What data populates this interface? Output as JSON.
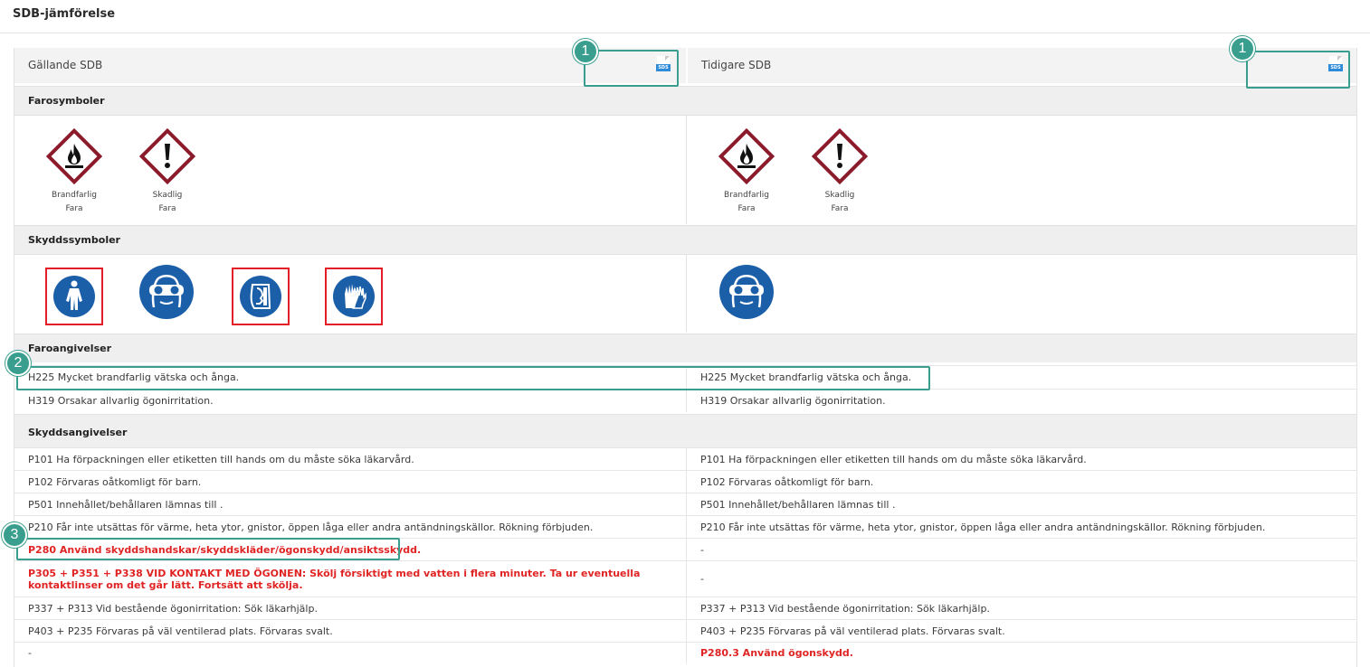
{
  "page": {
    "title": "SDB-jämförelse"
  },
  "columns": {
    "current": {
      "title": "Gällande SDB",
      "file_badge": "SDS"
    },
    "previous": {
      "title": "Tidigare SDB",
      "file_badge": "SDS"
    }
  },
  "sections": {
    "hazard_symbols": "Farosymboler",
    "protective_symbols": "Skyddssymboler",
    "hazard_statements": "Faroangivelser",
    "precautionary_statements": "Skyddsangivelser"
  },
  "hazard_symbols": {
    "current": [
      {
        "icon": "flame-pictogram-icon",
        "name": "Brandfarlig",
        "signal": "Fara"
      },
      {
        "icon": "exclamation-pictogram-icon",
        "name": "Skadlig",
        "signal": "Fara"
      }
    ],
    "previous": [
      {
        "icon": "flame-pictogram-icon",
        "name": "Brandfarlig",
        "signal": "Fara"
      },
      {
        "icon": "exclamation-pictogram-icon",
        "name": "Skadlig",
        "signal": "Fara"
      }
    ]
  },
  "protective_symbols": {
    "current": [
      {
        "icon": "protective-suit-icon",
        "highlighted": true
      },
      {
        "icon": "safety-goggles-icon",
        "highlighted": false
      },
      {
        "icon": "face-shield-icon",
        "highlighted": true
      },
      {
        "icon": "protective-gloves-icon",
        "highlighted": true
      }
    ],
    "previous": [
      {
        "icon": "safety-goggles-icon",
        "highlighted": false
      }
    ]
  },
  "hazard_statements": [
    {
      "current": "H225 Mycket brandfarlig vätska och ånga.",
      "previous": "H225 Mycket brandfarlig vätska och ånga.",
      "current_changed": false,
      "previous_changed": false
    },
    {
      "current": "H319 Orsakar allvarlig ögonirritation.",
      "previous": "H319 Orsakar allvarlig ögonirritation.",
      "current_changed": false,
      "previous_changed": false
    }
  ],
  "precautionary_statements": [
    {
      "current": "P101 Ha förpackningen eller etiketten till hands om du måste söka läkarvård.",
      "previous": "P101 Ha förpackningen eller etiketten till hands om du måste söka läkarvård.",
      "current_changed": false,
      "previous_changed": false
    },
    {
      "current": "P102 Förvaras oåtkomligt för barn.",
      "previous": "P102 Förvaras oåtkomligt för barn.",
      "current_changed": false,
      "previous_changed": false
    },
    {
      "current": "P501 Innehållet/behållaren lämnas till .",
      "previous": "P501 Innehållet/behållaren lämnas till .",
      "current_changed": false,
      "previous_changed": false
    },
    {
      "current": "P210 Får inte utsättas för värme, heta ytor, gnistor, öppen låga eller andra antändningskällor. Rökning förbjuden.",
      "previous": "P210 Får inte utsättas för värme, heta ytor, gnistor, öppen låga eller andra antändningskällor. Rökning förbjuden.",
      "current_changed": false,
      "previous_changed": false
    },
    {
      "current": "P280 Använd skyddshandskar/skyddskläder/ögonskydd/ansiktsskydd.",
      "previous": "-",
      "current_changed": true,
      "previous_changed": false
    },
    {
      "current": "P305 + P351 + P338 VID KONTAKT MED ÖGONEN: Skölj försiktigt med vatten i flera minuter. Ta ur eventuella kontaktlinser om det går lätt. Fortsätt att skölja.",
      "previous": "-",
      "current_changed": true,
      "previous_changed": false
    },
    {
      "current": "P337 + P313 Vid bestående ögonirritation: Sök läkarhjälp.",
      "previous": "P337 + P313 Vid bestående ögonirritation: Sök läkarhjälp.",
      "current_changed": false,
      "previous_changed": false
    },
    {
      "current": "P403 + P235 Förvaras på väl ventilerad plats. Förvaras svalt.",
      "previous": "P403 + P235 Förvaras på väl ventilerad plats. Förvaras svalt.",
      "current_changed": false,
      "previous_changed": false
    },
    {
      "current": "-",
      "previous": "P280.3 Använd ögonskydd.",
      "current_changed": false,
      "previous_changed": true
    }
  ],
  "callouts": [
    "1",
    "1",
    "2",
    "3"
  ],
  "colors": {
    "teal_callout": "#3a9e8f",
    "changed_text": "#e02424",
    "ghs_border": "#8b1a2b",
    "ppe_blue": "#1b5fa8",
    "highlight_frame": "#e41e26"
  }
}
